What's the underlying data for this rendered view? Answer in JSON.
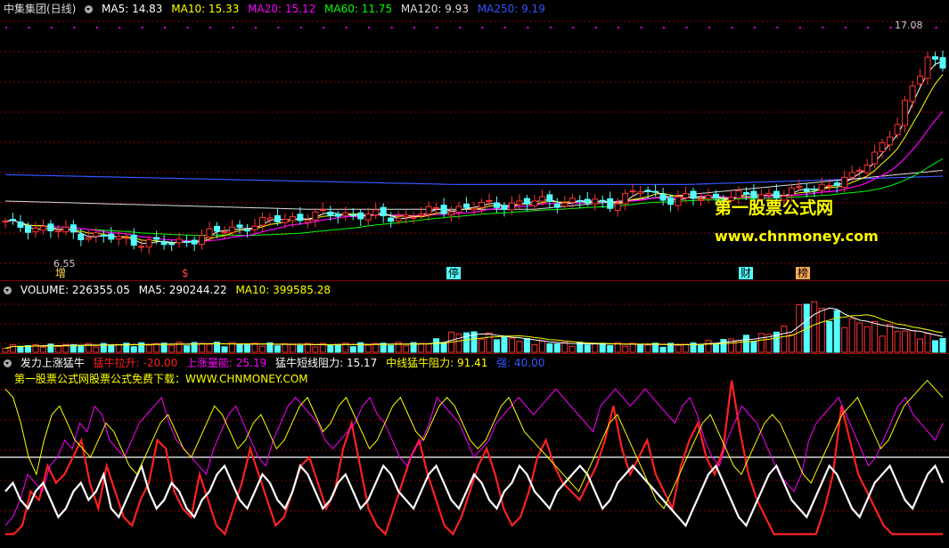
{
  "panel1": {
    "title": "中集集团(日线)",
    "indicators": [
      {
        "label": "MA5: 14.83",
        "color": "#ffffff"
      },
      {
        "label": "MA10: 15.33",
        "color": "#ffff00"
      },
      {
        "label": "MA20: 15.12",
        "color": "#ff00ff"
      },
      {
        "label": "MA60: 11.75",
        "color": "#00ff00"
      },
      {
        "label": "MA120: 9.93",
        "color": "#dddddd"
      },
      {
        "label": "MA250: 9.19",
        "color": "#3355ff"
      }
    ],
    "high_label": "17.08",
    "low_label": "6.55",
    "markers": [
      "增",
      "$",
      "停",
      "财",
      "榜"
    ],
    "watermark_cn": "第一股票公式网",
    "watermark_url": "www.chnmoney.com"
  },
  "panel2": {
    "indicators": [
      {
        "label": "VOLUME: 226355.05",
        "color": "#ffffff"
      },
      {
        "label": "MA5: 290244.22",
        "color": "#ffffff"
      },
      {
        "label": "MA10: 399585.28",
        "color": "#ffff00"
      }
    ]
  },
  "panel3": {
    "indicators": [
      {
        "label": "发力上涨猛牛",
        "color": "#ffffff"
      },
      {
        "label": "猛牛拉升: -20.00",
        "color": "#ff2020"
      },
      {
        "label": "上涨量能: 25.19",
        "color": "#ff00ff"
      },
      {
        "label": "猛牛短线阻力: 15.17",
        "color": "#ffffff"
      },
      {
        "label": "中线猛牛阻力: 91.41",
        "color": "#ffff00"
      },
      {
        "label": "强: 40.00",
        "color": "#3355ff"
      }
    ],
    "note": "第一股票公式网股票公式免费下载：WWW.CHNMONEY.COM"
  },
  "colors": {
    "up": "#ff3333",
    "down": "#54ffff",
    "grid": "#8b0000",
    "ma5": "#ffffff",
    "ma10": "#ffff00",
    "ma20": "#ff00ff",
    "ma60": "#00ff00",
    "ma120": "#dddddd",
    "ma250": "#3355ff"
  },
  "chart_data": [
    {
      "type": "candlestick",
      "n_bars": 125,
      "price_anchors": [
        [
          0,
          7.6
        ],
        [
          8,
          7.2
        ],
        [
          16,
          6.8
        ],
        [
          22,
          6.6
        ],
        [
          28,
          7.2
        ],
        [
          36,
          7.8
        ],
        [
          44,
          8.1
        ],
        [
          52,
          7.9
        ],
        [
          58,
          8.3
        ],
        [
          64,
          8.5
        ],
        [
          72,
          8.7
        ],
        [
          80,
          8.6
        ],
        [
          84,
          9.2
        ],
        [
          88,
          8.8
        ],
        [
          96,
          8.9
        ],
        [
          104,
          9.1
        ],
        [
          112,
          9.8
        ],
        [
          116,
          11.5
        ],
        [
          118,
          12.4
        ],
        [
          120,
          14.2
        ],
        [
          122,
          15.8
        ],
        [
          124,
          15.2
        ]
      ],
      "high_price": 17.08,
      "low_price": 6.55
    },
    {
      "type": "bar",
      "name": "VOLUME",
      "volume_anchors": [
        [
          0,
          0.25
        ],
        [
          12,
          0.3
        ],
        [
          26,
          0.35
        ],
        [
          40,
          0.3
        ],
        [
          56,
          0.35
        ],
        [
          60,
          0.8
        ],
        [
          72,
          0.35
        ],
        [
          90,
          0.3
        ],
        [
          96,
          0.5
        ],
        [
          100,
          0.65
        ],
        [
          104,
          1.0
        ],
        [
          106,
          2.2
        ],
        [
          108,
          1.6
        ],
        [
          112,
          1.2
        ],
        [
          118,
          0.9
        ],
        [
          124,
          0.5
        ]
      ]
    },
    {
      "type": "line",
      "series": [
        {
          "name": "猛牛拉升",
          "color": "#ff2020",
          "values": [
            5,
            5,
            10,
            30,
            25,
            45,
            35,
            40,
            50,
            60,
            35,
            20,
            45,
            30,
            15,
            10,
            25,
            35,
            60,
            55,
            30,
            20,
            15,
            40,
            25,
            10,
            5,
            20,
            35,
            55,
            40,
            25,
            10,
            15,
            30,
            45,
            50,
            35,
            20,
            30,
            55,
            70,
            45,
            20,
            10,
            5,
            20,
            35,
            50,
            60,
            40,
            25,
            10,
            5,
            15,
            30,
            45,
            55,
            40,
            20,
            10,
            15,
            30,
            50,
            60,
            45,
            35,
            30,
            25,
            35,
            45,
            60,
            80,
            55,
            40,
            50,
            60,
            40,
            30,
            20,
            45,
            60,
            70,
            50,
            40,
            55,
            95,
            65,
            40,
            25,
            15,
            5,
            5,
            5,
            5,
            5,
            5,
            20,
            40,
            80,
            60,
            40,
            30,
            20,
            10,
            5,
            5,
            5,
            5,
            5,
            5,
            5
          ]
        },
        {
          "name": "上涨量能",
          "color": "#ff00ff",
          "values": [
            10,
            15,
            25,
            40,
            35,
            30,
            45,
            50,
            60,
            55,
            70,
            65,
            80,
            75,
            60,
            55,
            50,
            60,
            70,
            75,
            80,
            85,
            70,
            60,
            55,
            50,
            45,
            40,
            55,
            65,
            75,
            80,
            70,
            60,
            50,
            45,
            60,
            70,
            80,
            85,
            80,
            75,
            70,
            60,
            55,
            60,
            65,
            70,
            80,
            85,
            75,
            70,
            60,
            50,
            45,
            55,
            60,
            70,
            85,
            80,
            75,
            70,
            60,
            50,
            55,
            60,
            70,
            75,
            80,
            85,
            80,
            75,
            80,
            85,
            90,
            85,
            80,
            75,
            70,
            65,
            80,
            85,
            90,
            85,
            80,
            85,
            90,
            85,
            80,
            75,
            70,
            80,
            85,
            75,
            60,
            50,
            45,
            60,
            70,
            80,
            75,
            70,
            60,
            50,
            40,
            35,
            30,
            40,
            60,
            70,
            75,
            80,
            85,
            75,
            65,
            55,
            45,
            50,
            60,
            70,
            80,
            85,
            75,
            70,
            65,
            60,
            70
          ]
        },
        {
          "name": "猛牛短线阻力",
          "color": "#ffffff",
          "values": [
            30,
            35,
            25,
            20,
            30,
            35,
            25,
            15,
            20,
            30,
            35,
            25,
            30,
            40,
            20,
            15,
            25,
            35,
            45,
            30,
            20,
            25,
            35,
            30,
            20,
            15,
            25,
            30,
            40,
            45,
            35,
            25,
            20,
            30,
            40,
            35,
            25,
            20,
            30,
            45,
            40,
            30,
            20,
            25,
            35,
            40,
            30,
            20,
            25,
            35,
            45,
            40,
            30,
            25,
            20,
            30,
            40,
            45,
            35,
            25,
            20,
            30,
            40,
            35,
            25,
            20,
            30,
            35,
            45,
            40,
            30,
            25,
            20,
            30,
            35,
            40,
            45,
            40,
            30,
            20,
            25,
            35,
            40,
            45,
            40,
            35,
            30,
            25,
            20,
            15,
            10,
            20,
            30,
            40,
            45,
            35,
            25,
            15,
            10,
            20,
            30,
            40,
            45,
            35,
            25,
            20,
            15,
            25,
            35,
            45,
            40,
            30,
            20,
            15,
            25,
            35,
            40,
            45,
            35,
            25,
            20,
            30,
            40,
            45,
            35
          ]
        },
        {
          "name": "中线猛牛阻力",
          "color": "#ffff00",
          "values": [
            90,
            85,
            70,
            50,
            40,
            60,
            75,
            80,
            70,
            60,
            55,
            50,
            60,
            70,
            65,
            55,
            45,
            40,
            50,
            60,
            70,
            75,
            65,
            55,
            50,
            60,
            70,
            80,
            75,
            65,
            55,
            60,
            70,
            75,
            65,
            55,
            60,
            70,
            80,
            85,
            75,
            65,
            70,
            80,
            85,
            75,
            65,
            55,
            60,
            70,
            80,
            85,
            75,
            65,
            60,
            70,
            80,
            85,
            80,
            70,
            60,
            55,
            60,
            70,
            80,
            85,
            75,
            65,
            60,
            55,
            50,
            45,
            40,
            35,
            30,
            40,
            50,
            60,
            70,
            75,
            65,
            55,
            45,
            35,
            25,
            20,
            30,
            40,
            50,
            60,
            70,
            75,
            65,
            55,
            45,
            40,
            50,
            60,
            70,
            75,
            70,
            60,
            50,
            40,
            35,
            45,
            55,
            65,
            75,
            80,
            85,
            75,
            65,
            55,
            60,
            70,
            80,
            85,
            90,
            95,
            90,
            85
          ]
        }
      ],
      "reference_level": 50
    }
  ]
}
